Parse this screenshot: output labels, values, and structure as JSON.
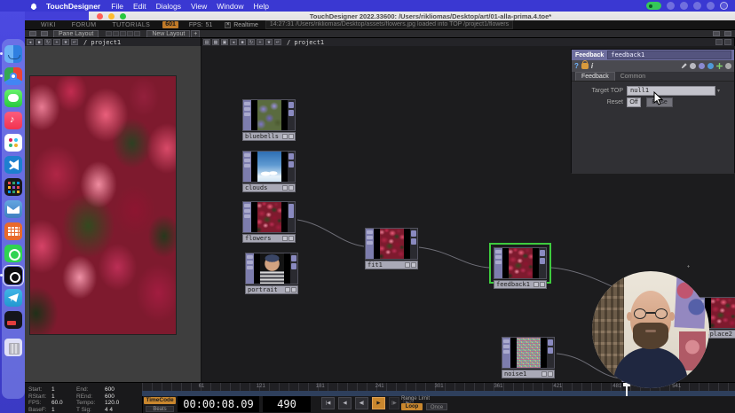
{
  "menubar": {
    "app_name": "TouchDesigner",
    "items": [
      "File",
      "Edit",
      "Dialogs",
      "View",
      "Window",
      "Help"
    ],
    "status_icons": [
      "screen-recording-pill",
      "input-source",
      "display",
      "capture",
      "user-switch",
      "control-center"
    ]
  },
  "window": {
    "title": "TouchDesigner 2022.33600: /Users/rikliomas/Desktop/art/01-alla-prima.4.toe*"
  },
  "toolbar": {
    "links": [
      "WIKI",
      "FORUM",
      "TUTORIALS"
    ],
    "badge": "601",
    "fps_label": "FPS:",
    "fps_value": "51",
    "realtime_check": "×",
    "realtime_label": "Realtime",
    "status_message": "14:27:31 /Users/rikliomas/Desktop/assets/flowers.jpg loaded into TOP /project1/flowers"
  },
  "layout_toolbar": {
    "pane_layout_label": "Pane Layout",
    "new_layout_label": "New Layout",
    "new_layout_plus": "+"
  },
  "pane_left": {
    "path": "/ project1",
    "buttons": [
      {
        "name": "back-arrow-button",
        "glyph": "◂"
      },
      {
        "name": "stop-button",
        "glyph": "■"
      },
      {
        "name": "refresh-button",
        "glyph": "↻"
      },
      {
        "name": "add-button",
        "glyph": "+"
      },
      {
        "name": "bookmark-button",
        "glyph": "★"
      },
      {
        "name": "enter-button",
        "glyph": "↵"
      }
    ]
  },
  "pane_network": {
    "path": "/ project1",
    "buttons": [
      {
        "name": "split-horizontal-button",
        "glyph": "▤"
      },
      {
        "name": "split-vertical-button",
        "glyph": "▦"
      },
      {
        "name": "maximize-pane-button",
        "glyph": "▣"
      },
      {
        "name": "back-arrow-button",
        "glyph": "◂"
      },
      {
        "name": "stop-button",
        "glyph": "■"
      },
      {
        "name": "refresh-button",
        "glyph": "↻"
      },
      {
        "name": "add-button",
        "glyph": "+"
      },
      {
        "name": "bookmark-button",
        "glyph": "★"
      },
      {
        "name": "enter-button",
        "glyph": "↵"
      }
    ]
  },
  "nodes": [
    {
      "name": "bluebells"
    },
    {
      "name": "clouds"
    },
    {
      "name": "flowers"
    },
    {
      "name": "portrait"
    },
    {
      "name": "fit1"
    },
    {
      "name": "feedback1"
    },
    {
      "name": "noise1"
    },
    {
      "name": "displace2"
    }
  ],
  "param_dialog": {
    "family": "Feedback",
    "node_name": "feedback1",
    "help_label": "?",
    "info_label": "i",
    "tabs": [
      {
        "label": "Feedback"
      },
      {
        "label": "Common"
      }
    ],
    "target_top_label": "Target TOP",
    "target_top_value": "null1",
    "reset_label": "Reset",
    "reset_off": "Off",
    "reset_pulse": "Pulse"
  },
  "timeline": {
    "fields_left": [
      {
        "label": "Start:",
        "value": "1"
      },
      {
        "label": "RStart:",
        "value": "1"
      },
      {
        "label": "FPS:",
        "value": "60.0"
      },
      {
        "label": "BaseF:",
        "value": "1"
      }
    ],
    "fields_right": [
      {
        "label": "End:",
        "value": "600"
      },
      {
        "label": "REnd:",
        "value": "600"
      },
      {
        "label": "Tempo:",
        "value": "120.0"
      },
      {
        "label": "T Sig:",
        "value": "4  4"
      }
    ],
    "timecode_label": "TimeCode",
    "beats_label": "Beats",
    "timecode": "00:00:08.09",
    "frame": "490",
    "range_limit_label": "Range Limit",
    "loop_label": "Loop",
    "once_label": "Once",
    "frame_start": 1,
    "frame_end": 600,
    "playhead_frame": 490,
    "ruler_ticks": [
      61,
      121,
      181,
      241,
      301,
      361,
      421,
      481,
      541
    ],
    "transport": [
      {
        "name": "skip-to-start-button",
        "glyph": "|◀"
      },
      {
        "name": "play-reverse-button",
        "glyph": "◀"
      },
      {
        "name": "step-back-button",
        "glyph": "◀|"
      },
      {
        "name": "play-forward-button",
        "glyph": "▶",
        "active": true
      },
      {
        "name": "step-forward-button",
        "glyph": "|▶",
        "dim": true
      },
      {
        "name": "skip-to-end-button",
        "glyph": "▶|",
        "dim": true
      }
    ]
  },
  "dock": {
    "items": [
      {
        "id": "finder",
        "running": true
      },
      {
        "id": "chrome",
        "running": true
      },
      {
        "id": "messages"
      },
      {
        "id": "music"
      },
      {
        "id": "slack"
      },
      {
        "id": "vscode"
      },
      {
        "id": "pixel-grid-app"
      },
      {
        "id": "mail"
      },
      {
        "id": "calendar"
      },
      {
        "id": "whatsapp"
      },
      {
        "id": "touchdesigner",
        "running": true
      },
      {
        "id": "telegram"
      },
      {
        "id": "stream-app"
      },
      {
        "id": "trash"
      }
    ]
  }
}
